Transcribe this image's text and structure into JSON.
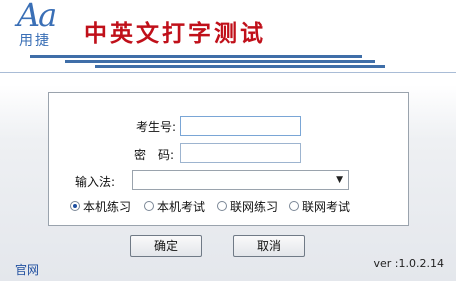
{
  "header": {
    "logo_top": "Aa",
    "logo_bottom": "用捷",
    "title": "中英文打字测试"
  },
  "form": {
    "exam_id_label": "考生号:",
    "exam_id_value": "",
    "password_label": "密　码:",
    "password_value": "",
    "ime_label": "输入法:",
    "ime_selected": "",
    "modes": [
      {
        "label": "本机练习",
        "checked": true
      },
      {
        "label": "本机考试",
        "checked": false
      },
      {
        "label": "联网练习",
        "checked": false
      },
      {
        "label": "联网考试",
        "checked": false
      }
    ]
  },
  "buttons": {
    "ok": "确定",
    "cancel": "取消"
  },
  "footer": {
    "link": "官网",
    "version": "ver :1.0.2.14"
  },
  "colors": {
    "title": "#c0101a",
    "accent": "#3f6ea8"
  }
}
